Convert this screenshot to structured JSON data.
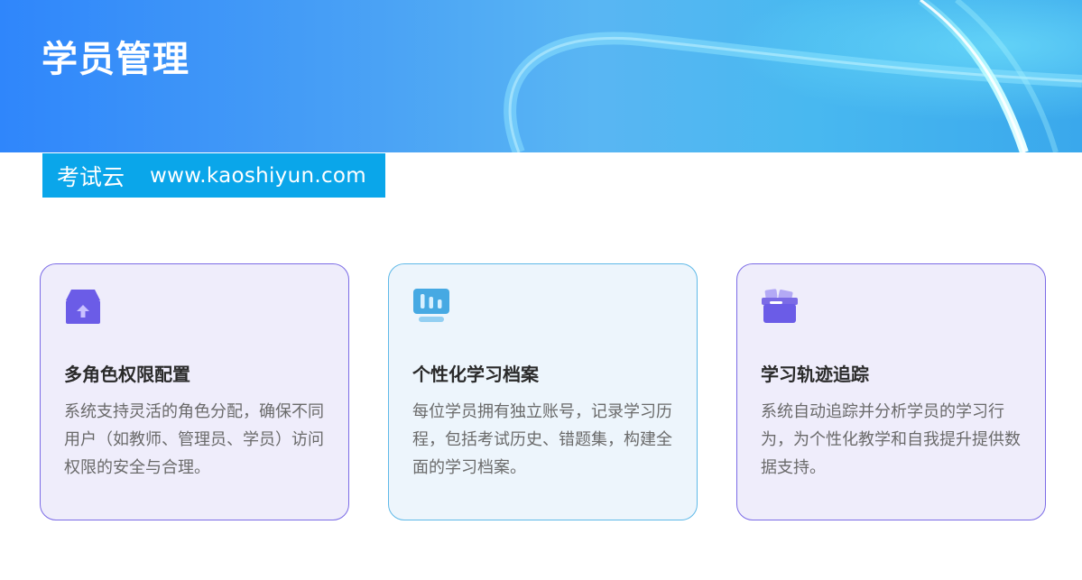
{
  "header": {
    "title": "学员管理",
    "brand_name": "考试云",
    "brand_url": "www.kaoshiyun.com"
  },
  "cards": [
    {
      "icon": "box-upload-icon",
      "title": "多角色权限配置",
      "description": "系统支持灵活的角色分配，确保不同用户（如教师、管理员、学员）访问权限的安全与合理。"
    },
    {
      "icon": "bar-chart-icon",
      "title": "个性化学习档案",
      "description": "每位学员拥有独立账号，记录学习历程，包括考试历史、错题集，构建全面的学习档案。"
    },
    {
      "icon": "archive-box-icon",
      "title": "学习轨迹追踪",
      "description": "系统自动追踪并分析学员的学习行为，为个性化教学和自我提升提供数据支持。"
    }
  ],
  "colors": {
    "banner_start": "#2f86fb",
    "brand_tag": "#0aa6ea",
    "purple_accent": "#7b6be6",
    "blue_accent": "#5fb9e8"
  }
}
